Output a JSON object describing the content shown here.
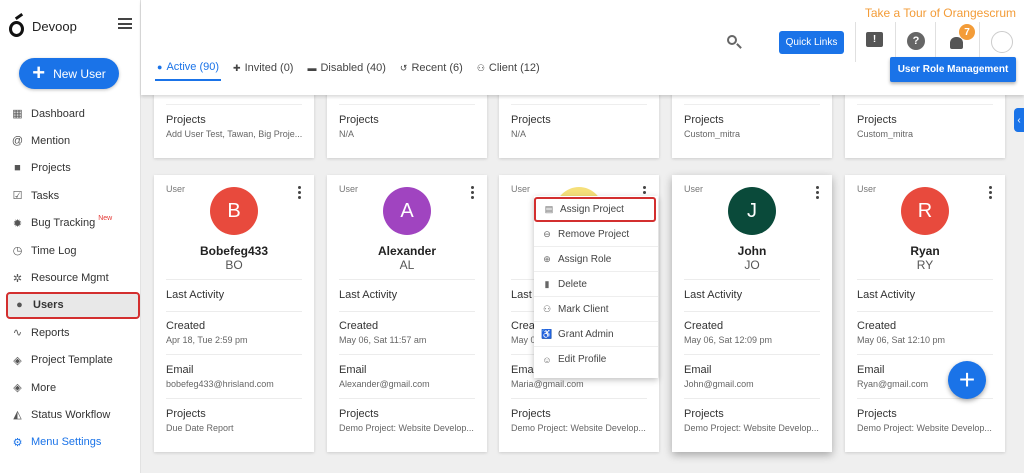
{
  "app": {
    "name": "Devoop",
    "tour_link": "Take a Tour of Orangescrum"
  },
  "sidebar": {
    "new_user_label": "New User",
    "items": [
      {
        "label": "Dashboard",
        "icon": "dashboard-icon"
      },
      {
        "label": "Mention",
        "icon": "at-icon"
      },
      {
        "label": "Projects",
        "icon": "briefcase-icon"
      },
      {
        "label": "Tasks",
        "icon": "checkbox-icon"
      },
      {
        "label": "Bug Tracking",
        "badge": "New",
        "icon": "bug-icon"
      },
      {
        "label": "Time Log",
        "icon": "clock-icon"
      },
      {
        "label": "Resource Mgmt",
        "icon": "resource-icon"
      },
      {
        "label": "Users",
        "icon": "user-icon",
        "active": true
      },
      {
        "label": "Reports",
        "icon": "trend-icon"
      },
      {
        "label": "Project Template",
        "icon": "layers-icon"
      },
      {
        "label": "More",
        "icon": "layers-icon"
      },
      {
        "label": "Status Workflow",
        "icon": "workflow-icon"
      },
      {
        "label": "Menu Settings",
        "icon": "gear-icon"
      }
    ]
  },
  "header": {
    "quick_links": "Quick Links",
    "notification_count": "7",
    "user_role_management": "User Role Management",
    "tabs": [
      {
        "label": "Active (90)",
        "active": true
      },
      {
        "label": "Invited (0)"
      },
      {
        "label": "Disabled (40)"
      },
      {
        "label": "Recent (6)"
      },
      {
        "label": "Client (12)"
      }
    ]
  },
  "top_cards": [
    {
      "projects_label": "Projects",
      "projects": "Add User Test, Tawan, Big Proje..."
    },
    {
      "projects_label": "Projects",
      "projects": "N/A"
    },
    {
      "projects_label": "Projects",
      "projects": "N/A"
    },
    {
      "projects_label": "Projects",
      "projects": "Custom_mitra"
    },
    {
      "projects_label": "Projects",
      "projects": "Custom_mitra"
    }
  ],
  "users": [
    {
      "role": "User",
      "initial": "B",
      "name": "Bobefeg433",
      "initials": "BO",
      "color": "#e84a3d",
      "last_activity_label": "Last Activity",
      "created_label": "Created",
      "created": "Apr 18, Tue 2:59 pm",
      "email_label": "Email",
      "email": "bobefeg433@hrisland.com",
      "projects_label": "Projects",
      "projects": "Due Date Report"
    },
    {
      "role": "User",
      "initial": "A",
      "name": "Alexander",
      "initials": "AL",
      "color": "#a044c0",
      "last_activity_label": "Last Activity",
      "created_label": "Created",
      "created": "May 06, Sat 11:57 am",
      "email_label": "Email",
      "email": "Alexander@gmail.com",
      "projects_label": "Projects",
      "projects": "Demo Project: Website Develop..."
    },
    {
      "role": "User",
      "initial": "",
      "name": "",
      "initials": "",
      "color": "#f5df7a",
      "last_activity_label": "Last Activity",
      "created_label": "Created",
      "created": "May 0",
      "email_label": "Email",
      "email": "Maria@gmail.com",
      "projects_label": "Projects",
      "projects": "Demo Project: Website Develop..."
    },
    {
      "role": "User",
      "initial": "J",
      "name": "John",
      "initials": "JO",
      "color": "#0a4a3a",
      "last_activity_label": "Last Activity",
      "created_label": "Created",
      "created": "May 06, Sat 12:09 pm",
      "email_label": "Email",
      "email": "John@gmail.com",
      "projects_label": "Projects",
      "projects": "Demo Project: Website Develop..."
    },
    {
      "role": "User",
      "initial": "R",
      "name": "Ryan",
      "initials": "RY",
      "color": "#e84a3d",
      "last_activity_label": "Last Activity",
      "created_label": "Created",
      "created": "May 06, Sat 12:10 pm",
      "email_label": "Email",
      "email": "Ryan@gmail.com",
      "projects_label": "Projects",
      "projects": "Demo Project: Website Develop..."
    }
  ],
  "context_menu": [
    {
      "label": "Assign Project",
      "icon": "clipboard-icon",
      "highlighted": true
    },
    {
      "label": "Remove Project",
      "icon": "minus-circle-icon"
    },
    {
      "label": "Assign Role",
      "icon": "plus-circle-icon"
    },
    {
      "label": "Delete",
      "icon": "trash-icon"
    },
    {
      "label": "Mark Client",
      "icon": "group-icon"
    },
    {
      "label": "Grant Admin",
      "icon": "accessibility-icon"
    },
    {
      "label": "Edit Profile",
      "icon": "person-icon"
    }
  ],
  "fab_label": "+"
}
